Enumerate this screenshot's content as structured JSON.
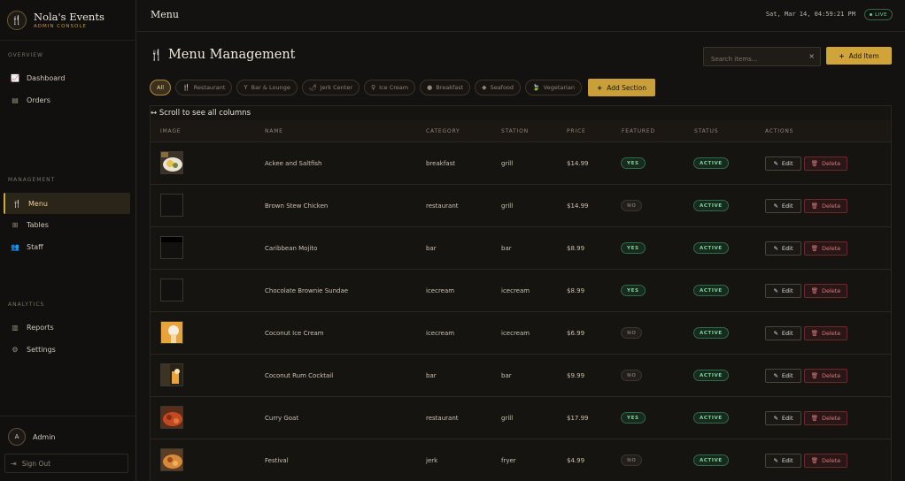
{
  "brand": {
    "title": "Nola's Events",
    "subtitle": "ADMIN CONSOLE"
  },
  "sidebar": {
    "sections": [
      {
        "label": "OVERVIEW"
      },
      {
        "label": "MANAGEMENT"
      },
      {
        "label": "ANALYTICS"
      }
    ],
    "items": [
      {
        "label": "Dashboard",
        "icon": "chart-line-icon"
      },
      {
        "label": "Orders",
        "icon": "receipt-icon"
      },
      {
        "label": "Menu",
        "icon": "utensils-icon",
        "active": true
      },
      {
        "label": "Tables",
        "icon": "chair-icon"
      },
      {
        "label": "Staff",
        "icon": "users-icon"
      },
      {
        "label": "Reports",
        "icon": "bar-chart-icon"
      },
      {
        "label": "Settings",
        "icon": "gear-icon"
      }
    ],
    "user": {
      "initial": "A",
      "name": "Admin"
    },
    "signout": "Sign Out"
  },
  "header": {
    "title": "Menu",
    "datetime": "Sat, Mar 14, 04:59:21 PM",
    "live": "LIVE"
  },
  "page": {
    "heading": "Menu Management",
    "search_placeholder": "Search items...",
    "add_item": "Add Item",
    "add_section": "Add Section",
    "scroll_hint": "↔ Scroll to see all columns"
  },
  "filters": [
    {
      "label": "All",
      "active": true,
      "icon": ""
    },
    {
      "label": "Restaurant",
      "icon": "utensils-icon"
    },
    {
      "label": "Bar & Lounge",
      "icon": "cocktail-icon"
    },
    {
      "label": "Jerk Center",
      "icon": "pepper-icon"
    },
    {
      "label": "Ice Cream",
      "icon": "ice-cream-icon"
    },
    {
      "label": "Breakfast",
      "icon": "egg-icon"
    },
    {
      "label": "Seafood",
      "icon": "fish-icon"
    },
    {
      "label": "Vegetarian",
      "icon": "leaf-icon"
    }
  ],
  "table": {
    "columns": [
      "IMAGE",
      "NAME",
      "CATEGORY",
      "STATION",
      "PRICE",
      "FEATURED",
      "STATUS",
      "ACTIONS"
    ],
    "rows": [
      {
        "name": "Ackee and Saltfish",
        "category": "breakfast",
        "station": "grill",
        "price": "$14.99",
        "featured": "YES",
        "status": "ACTIVE",
        "image": "plate"
      },
      {
        "name": "Brown Stew Chicken",
        "category": "restaurant",
        "station": "grill",
        "price": "$14.99",
        "featured": "NO",
        "status": "ACTIVE",
        "image": "empty"
      },
      {
        "name": "Caribbean Mojito",
        "category": "bar",
        "station": "bar",
        "price": "$8.99",
        "featured": "YES",
        "status": "ACTIVE",
        "image": "dark"
      },
      {
        "name": "Chocolate Brownie Sundae",
        "category": "icecream",
        "station": "icecream",
        "price": "$8.99",
        "featured": "YES",
        "status": "ACTIVE",
        "image": "empty"
      },
      {
        "name": "Coconut Ice Cream",
        "category": "icecream",
        "station": "icecream",
        "price": "$6.99",
        "featured": "NO",
        "status": "ACTIVE",
        "image": "icecream"
      },
      {
        "name": "Coconut Rum Cocktail",
        "category": "bar",
        "station": "bar",
        "price": "$9.99",
        "featured": "NO",
        "status": "ACTIVE",
        "image": "cocktail"
      },
      {
        "name": "Curry Goat",
        "category": "restaurant",
        "station": "grill",
        "price": "$17.99",
        "featured": "YES",
        "status": "ACTIVE",
        "image": "curry"
      },
      {
        "name": "Festival",
        "category": "jerk",
        "station": "fryer",
        "price": "$4.99",
        "featured": "NO",
        "status": "ACTIVE",
        "image": "festival"
      }
    ],
    "edit_label": "Edit",
    "delete_label": "Delete"
  },
  "colors": {
    "accent": "#d1a43a",
    "active_green": "#7ed59a",
    "danger": "#d97a7a"
  }
}
